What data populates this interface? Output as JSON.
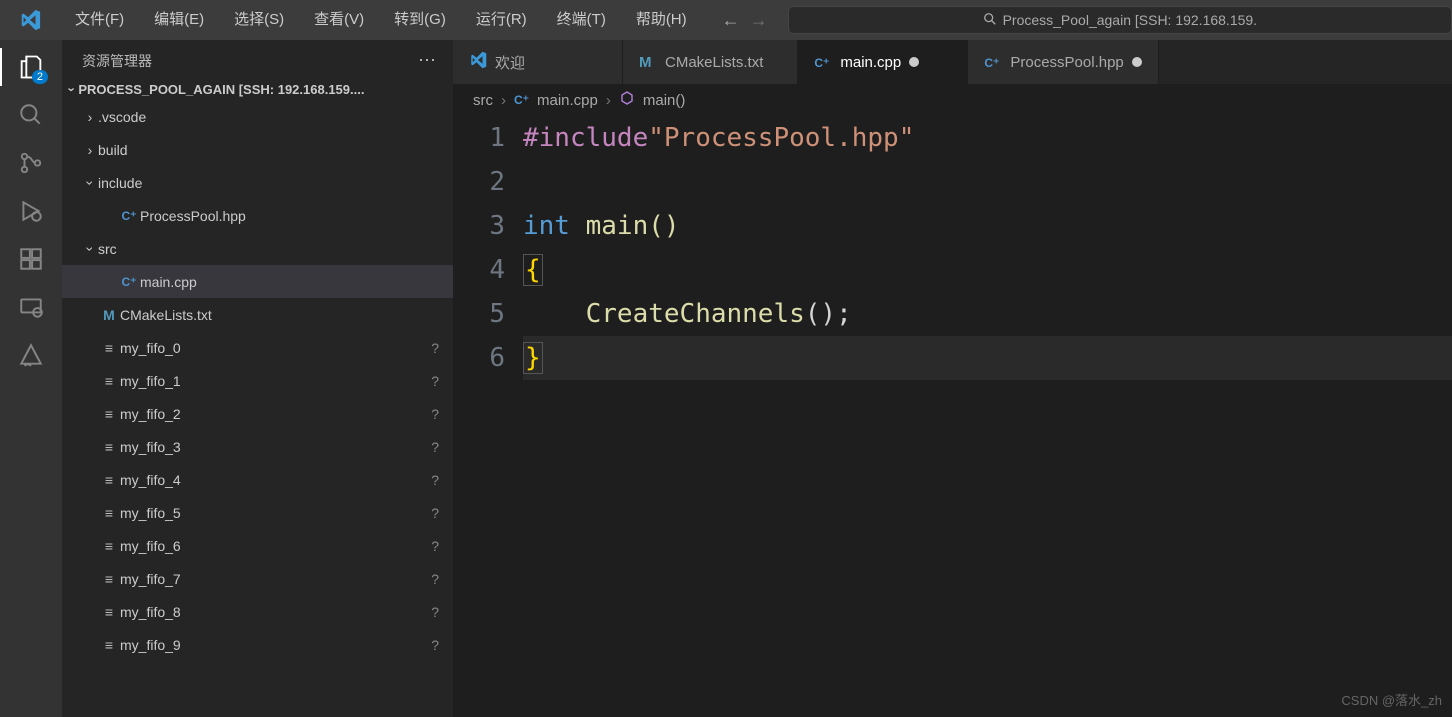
{
  "menu": {
    "items": [
      "文件(F)",
      "编辑(E)",
      "选择(S)",
      "查看(V)",
      "转到(G)",
      "运行(R)",
      "终端(T)",
      "帮助(H)"
    ]
  },
  "search_placeholder": "Process_Pool_again [SSH: 192.168.159.",
  "activity_badge": "2",
  "sidebar": {
    "title": "资源管理器",
    "project": "PROCESS_POOL_AGAIN [SSH: 192.168.159....",
    "tree": [
      {
        "name": ".vscode",
        "type": "folder",
        "expanded": false,
        "level": 1
      },
      {
        "name": "build",
        "type": "folder",
        "expanded": false,
        "level": 1
      },
      {
        "name": "include",
        "type": "folder",
        "expanded": true,
        "level": 1
      },
      {
        "name": "ProcessPool.hpp",
        "type": "cpp",
        "level": 2
      },
      {
        "name": "src",
        "type": "folder",
        "expanded": true,
        "level": 1
      },
      {
        "name": "main.cpp",
        "type": "cpp",
        "level": 2,
        "selected": true
      },
      {
        "name": "CMakeLists.txt",
        "type": "cmake",
        "level": 1
      },
      {
        "name": "my_fifo_0",
        "type": "file",
        "level": 1,
        "status": "?"
      },
      {
        "name": "my_fifo_1",
        "type": "file",
        "level": 1,
        "status": "?"
      },
      {
        "name": "my_fifo_2",
        "type": "file",
        "level": 1,
        "status": "?"
      },
      {
        "name": "my_fifo_3",
        "type": "file",
        "level": 1,
        "status": "?"
      },
      {
        "name": "my_fifo_4",
        "type": "file",
        "level": 1,
        "status": "?"
      },
      {
        "name": "my_fifo_5",
        "type": "file",
        "level": 1,
        "status": "?"
      },
      {
        "name": "my_fifo_6",
        "type": "file",
        "level": 1,
        "status": "?"
      },
      {
        "name": "my_fifo_7",
        "type": "file",
        "level": 1,
        "status": "?"
      },
      {
        "name": "my_fifo_8",
        "type": "file",
        "level": 1,
        "status": "?"
      },
      {
        "name": "my_fifo_9",
        "type": "file",
        "level": 1,
        "status": "?"
      }
    ]
  },
  "tabs": [
    {
      "label": "欢迎",
      "icon": "vscode",
      "modified": false,
      "active": false
    },
    {
      "label": "CMakeLists.txt",
      "icon": "cmake",
      "modified": false,
      "active": false
    },
    {
      "label": "main.cpp",
      "icon": "cpp",
      "modified": true,
      "active": true
    },
    {
      "label": "ProcessPool.hpp",
      "icon": "cpp",
      "modified": true,
      "active": false
    }
  ],
  "breadcrumbs": {
    "folder": "src",
    "file": "main.cpp",
    "symbol": "main()"
  },
  "code": {
    "lines": [
      "1",
      "2",
      "3",
      "4",
      "5",
      "6"
    ],
    "include_stmt": "#include",
    "include_path": "\"ProcessPool.hpp\"",
    "kw_int": "int",
    "fn_main": "main",
    "parens": "()",
    "open_brace": "{",
    "close_brace": "}",
    "call": "CreateChannels",
    "call_end": "();"
  },
  "watermark": "CSDN @落水_zh"
}
